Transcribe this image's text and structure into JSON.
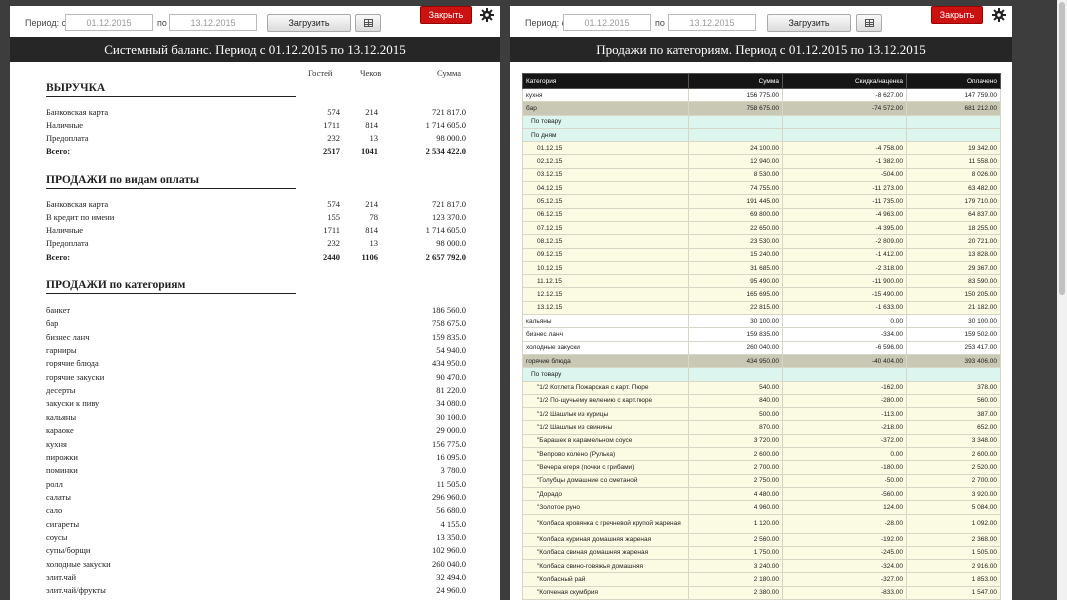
{
  "left": {
    "toolbar": {
      "period_label": "Период: с",
      "date_from": "01.12.2015",
      "to_label": "по",
      "date_to": "13.12.2015",
      "load_label": "Загрузить",
      "close_label": "Закрыть"
    },
    "title": "Системный баланс. Период с 01.12.2015 по 13.12.2015",
    "headers": {
      "guests": "Гостей",
      "checks": "Чеков",
      "sum": "Сумма"
    },
    "revenue": {
      "title": "ВЫРУЧКА",
      "rows": [
        {
          "name": "Банковская карта",
          "guests": "574",
          "checks": "214",
          "sum": "721 817.0"
        },
        {
          "name": "Наличные",
          "guests": "1711",
          "checks": "814",
          "sum": "1 714 605.0"
        },
        {
          "name": "Предоплата",
          "guests": "232",
          "checks": "13",
          "sum": "98 000.0"
        }
      ],
      "total": {
        "name": "Всего:",
        "guests": "2517",
        "checks": "1041",
        "sum": "2 534 422.0"
      }
    },
    "payments": {
      "title": "ПРОДАЖИ по видам оплаты",
      "rows": [
        {
          "name": "Банковская карта",
          "guests": "574",
          "checks": "214",
          "sum": "721 817.0"
        },
        {
          "name": "В кредит по имени",
          "guests": "155",
          "checks": "78",
          "sum": "123 370.0"
        },
        {
          "name": "Наличные",
          "guests": "1711",
          "checks": "814",
          "sum": "1 714 605.0"
        },
        {
          "name": "Предоплата",
          "guests": "232",
          "checks": "13",
          "sum": "98 000.0"
        }
      ],
      "total": {
        "name": "Всего:",
        "guests": "2440",
        "checks": "1106",
        "sum": "2 657 792.0"
      }
    },
    "categories": {
      "title": "ПРОДАЖИ по категориям",
      "rows": [
        {
          "name": "банкет",
          "sum": "186 560.0"
        },
        {
          "name": "бар",
          "sum": "758 675.0"
        },
        {
          "name": "бизнес ланч",
          "sum": "159 835.0"
        },
        {
          "name": "гарниры",
          "sum": "54 940.0"
        },
        {
          "name": "горячие блюда",
          "sum": "434 950.0"
        },
        {
          "name": "горячие закуски",
          "sum": "90 470.0"
        },
        {
          "name": "десерты",
          "sum": "81 220.0"
        },
        {
          "name": "закуски к пиву",
          "sum": "34 080.0"
        },
        {
          "name": "кальяны",
          "sum": "30 100.0"
        },
        {
          "name": "караоке",
          "sum": "29 000.0"
        },
        {
          "name": "кухня",
          "sum": "156 775.0"
        },
        {
          "name": "пирожки",
          "sum": "16 095.0"
        },
        {
          "name": "поминки",
          "sum": "3 780.0"
        },
        {
          "name": "ролл",
          "sum": "11 505.0"
        },
        {
          "name": "салаты",
          "sum": "296 960.0"
        },
        {
          "name": "сало",
          "sum": "56 680.0"
        },
        {
          "name": "сигареты",
          "sum": "4 155.0"
        },
        {
          "name": "соусы",
          "sum": "13 350.0"
        },
        {
          "name": "супы/борщи",
          "sum": "102 960.0"
        },
        {
          "name": "холодные закуски",
          "sum": "260 040.0"
        },
        {
          "name": "элит.чай",
          "sum": "32 494.0"
        },
        {
          "name": "элит.чай/фрукты",
          "sum": "24 960.0"
        }
      ]
    }
  },
  "right": {
    "toolbar": {
      "period_label": "Период: с",
      "date_from": "01.12.2015",
      "to_label": "по",
      "date_to": "13.12.2015",
      "load_label": "Загрузить",
      "close_label": "Закрыть"
    },
    "title": "Продажи по категориям. Период с 01.12.2015 по 13.12.2015",
    "columns": [
      "Категория",
      "Сумма",
      "Скидка/наценка",
      "Оплачено"
    ],
    "rows": [
      {
        "kind": "cat",
        "name": "кухня",
        "sum": "156 775.00",
        "disc": "-8 627.00",
        "paid": "147 759.00"
      },
      {
        "kind": "open",
        "name": "бар",
        "sum": "758 675.00",
        "disc": "-74 572.00",
        "paid": "681 212.00"
      },
      {
        "kind": "sub",
        "name": "По товару",
        "sum": "",
        "disc": "",
        "paid": ""
      },
      {
        "kind": "sub",
        "name": "По дням",
        "sum": "",
        "disc": "",
        "paid": ""
      },
      {
        "kind": "day",
        "name": "01.12.15",
        "sum": "24 100.00",
        "disc": "-4 758.00",
        "paid": "19 342.00"
      },
      {
        "kind": "day",
        "name": "02.12.15",
        "sum": "12 940.00",
        "disc": "-1 382.00",
        "paid": "11 558.00"
      },
      {
        "kind": "day",
        "name": "03.12.15",
        "sum": "8 530.00",
        "disc": "-504.00",
        "paid": "8 026.00"
      },
      {
        "kind": "day",
        "name": "04.12.15",
        "sum": "74 755.00",
        "disc": "-11 273.00",
        "paid": "63 482.00"
      },
      {
        "kind": "day",
        "name": "05.12.15",
        "sum": "191 445.00",
        "disc": "-11 735.00",
        "paid": "179 710.00"
      },
      {
        "kind": "day",
        "name": "06.12.15",
        "sum": "69 800.00",
        "disc": "-4 963.00",
        "paid": "64 837.00"
      },
      {
        "kind": "day",
        "name": "07.12.15",
        "sum": "22 650.00",
        "disc": "-4 395.00",
        "paid": "18 255.00"
      },
      {
        "kind": "day",
        "name": "08.12.15",
        "sum": "23 530.00",
        "disc": "-2 809.00",
        "paid": "20 721.00"
      },
      {
        "kind": "day",
        "name": "09.12.15",
        "sum": "15 240.00",
        "disc": "-1 412.00",
        "paid": "13 828.00"
      },
      {
        "kind": "day",
        "name": "10.12.15",
        "sum": "31 685.00",
        "disc": "-2 318.00",
        "paid": "29 367.00"
      },
      {
        "kind": "day",
        "name": "11.12.15",
        "sum": "95 490.00",
        "disc": "-11 900.00",
        "paid": "83 590.00"
      },
      {
        "kind": "day",
        "name": "12.12.15",
        "sum": "165 695.00",
        "disc": "-15 490.00",
        "paid": "150 205.00"
      },
      {
        "kind": "day",
        "name": "13.12.15",
        "sum": "22 815.00",
        "disc": "-1 633.00",
        "paid": "21 182.00"
      },
      {
        "kind": "cat",
        "name": "кальяны",
        "sum": "30 100.00",
        "disc": "0.00",
        "paid": "30 100.00"
      },
      {
        "kind": "cat",
        "name": "бизнес ланч",
        "sum": "159 835.00",
        "disc": "-334.00",
        "paid": "159 502.00"
      },
      {
        "kind": "cat",
        "name": "холодные закуски",
        "sum": "260 040.00",
        "disc": "-6 596.00",
        "paid": "253 417.00"
      },
      {
        "kind": "open",
        "name": "горячие блюда",
        "sum": "434 950.00",
        "disc": "-40 404.00",
        "paid": "393 406.00"
      },
      {
        "kind": "sub",
        "name": "По товару",
        "sum": "",
        "disc": "",
        "paid": ""
      },
      {
        "kind": "day",
        "name": "\"1/2 Котлета Пожарская с карт. Пюре",
        "sum": "540.00",
        "disc": "-162.00",
        "paid": "378.00"
      },
      {
        "kind": "day",
        "name": "\"1/2 По-щучьему велению с карт.пюре",
        "sum": "840.00",
        "disc": "-280.00",
        "paid": "560.00"
      },
      {
        "kind": "day",
        "name": "\"1/2 Шашлык из курицы",
        "sum": "500.00",
        "disc": "-113.00",
        "paid": "387.00"
      },
      {
        "kind": "day",
        "name": "\"1/2 Шашлык из свинины",
        "sum": "870.00",
        "disc": "-218.00",
        "paid": "652.00"
      },
      {
        "kind": "day",
        "name": "\"Барашек в карамельном соусе",
        "sum": "3 720.00",
        "disc": "-372.00",
        "paid": "3 348.00"
      },
      {
        "kind": "day",
        "name": "\"Вепрово колено (Рулька)",
        "sum": "2 600.00",
        "disc": "0.00",
        "paid": "2 600.00"
      },
      {
        "kind": "day",
        "name": "\"Вечера егеря (почки с грибами)",
        "sum": "2 700.00",
        "disc": "-180.00",
        "paid": "2 520.00"
      },
      {
        "kind": "day",
        "name": "\"Голубцы домашние со сметаной",
        "sum": "2 750.00",
        "disc": "-50.00",
        "paid": "2 700.00"
      },
      {
        "kind": "day",
        "name": "\"Дорадо",
        "sum": "4 480.00",
        "disc": "-560.00",
        "paid": "3 920.00"
      },
      {
        "kind": "day",
        "name": "\"Золотое руно",
        "sum": "4 960.00",
        "disc": "124.00",
        "paid": "5 084.00"
      },
      {
        "kind": "day2",
        "name": "\"Колбаса кровянка с гречневой крупой жареная",
        "sum": "1 120.00",
        "disc": "-28.00",
        "paid": "1 092.00"
      },
      {
        "kind": "day",
        "name": "\"Колбаса куриная домашняя жареная",
        "sum": "2 560.00",
        "disc": "-192.00",
        "paid": "2 368.00"
      },
      {
        "kind": "day",
        "name": "\"Колбаса свиная домашняя жареная",
        "sum": "1 750.00",
        "disc": "-245.00",
        "paid": "1 505.00"
      },
      {
        "kind": "day",
        "name": "\"Колбаса свино-говяжья домашняя",
        "sum": "3 240.00",
        "disc": "-324.00",
        "paid": "2 916.00"
      },
      {
        "kind": "day",
        "name": "\"Колбасный рай",
        "sum": "2 180.00",
        "disc": "-327.00",
        "paid": "1 853.00"
      },
      {
        "kind": "day",
        "name": "\"Копченая скумбрия",
        "sum": "2 380.00",
        "disc": "-833.00",
        "paid": "1 547.00"
      }
    ]
  }
}
